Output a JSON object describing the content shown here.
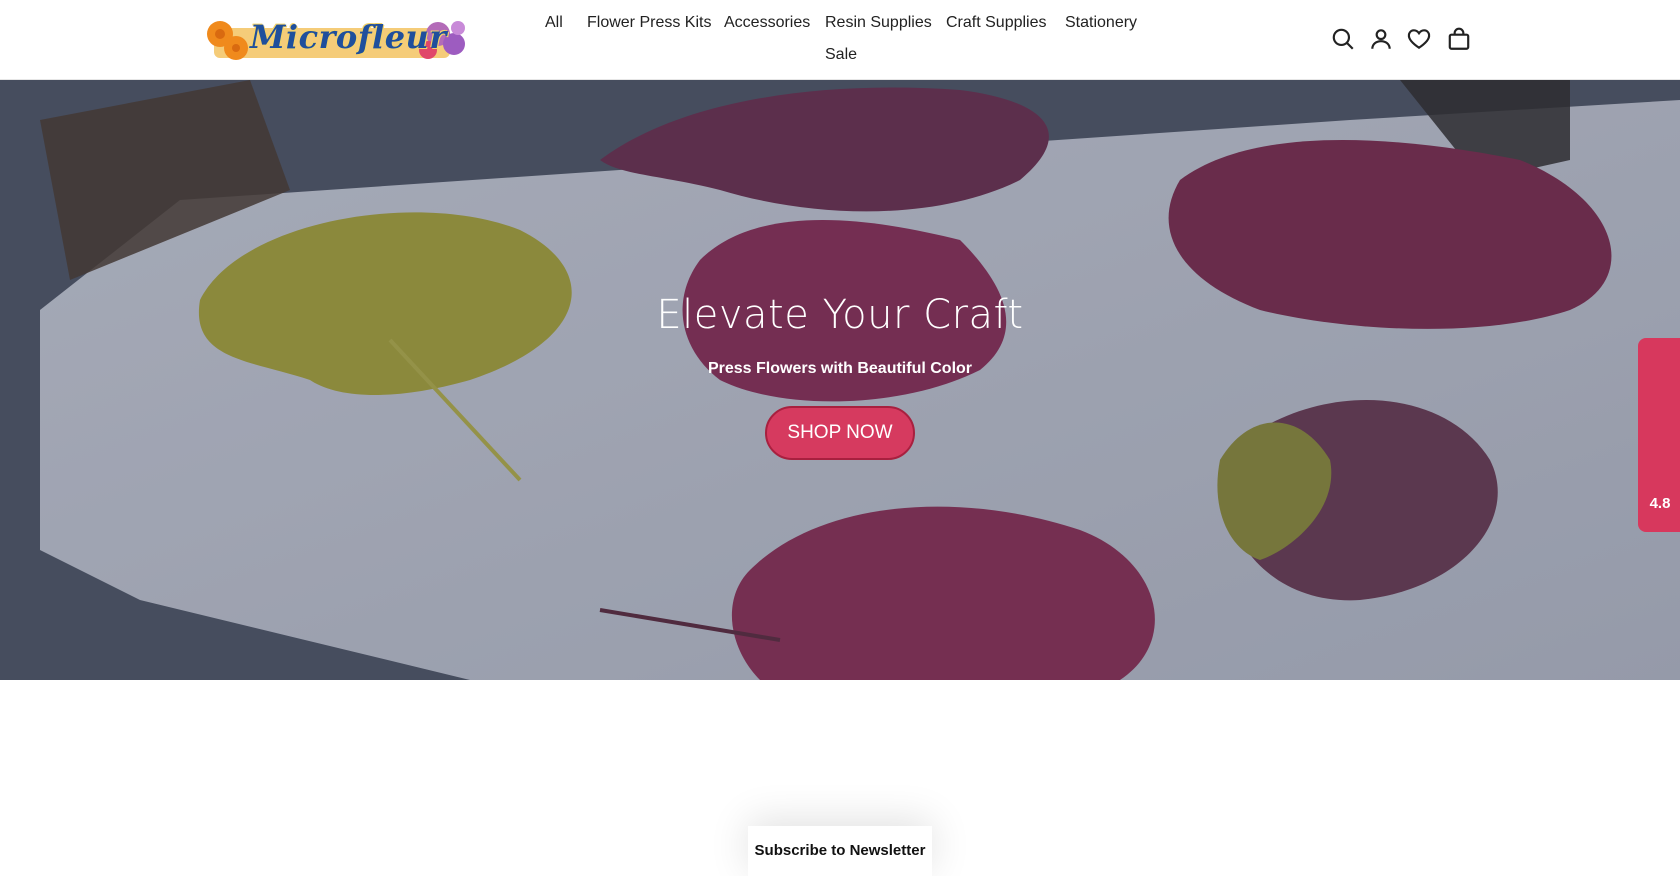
{
  "brand": {
    "name": "Microfleur"
  },
  "nav": {
    "items": [
      {
        "label": "All"
      },
      {
        "label": "Flower Press Kits"
      },
      {
        "label": "Accessories"
      },
      {
        "label": "Resin Supplies"
      },
      {
        "label": "Craft Supplies"
      },
      {
        "label": "Stationery"
      },
      {
        "label": "Sale"
      }
    ]
  },
  "header_icons": [
    "search-icon",
    "account-icon",
    "wishlist-heart-icon",
    "cart-bag-icon"
  ],
  "hero": {
    "title": "Elevate Your Craft",
    "subtitle": "Press Flowers with Beautiful Color",
    "cta_label": "SHOP NOW"
  },
  "reviews": {
    "score": "4.8"
  },
  "newsletter": {
    "label": "Subscribe to Newsletter"
  },
  "colors": {
    "accent": "#d63a5f",
    "nav_text": "#222222",
    "brand_blue": "#1f4f9c"
  }
}
